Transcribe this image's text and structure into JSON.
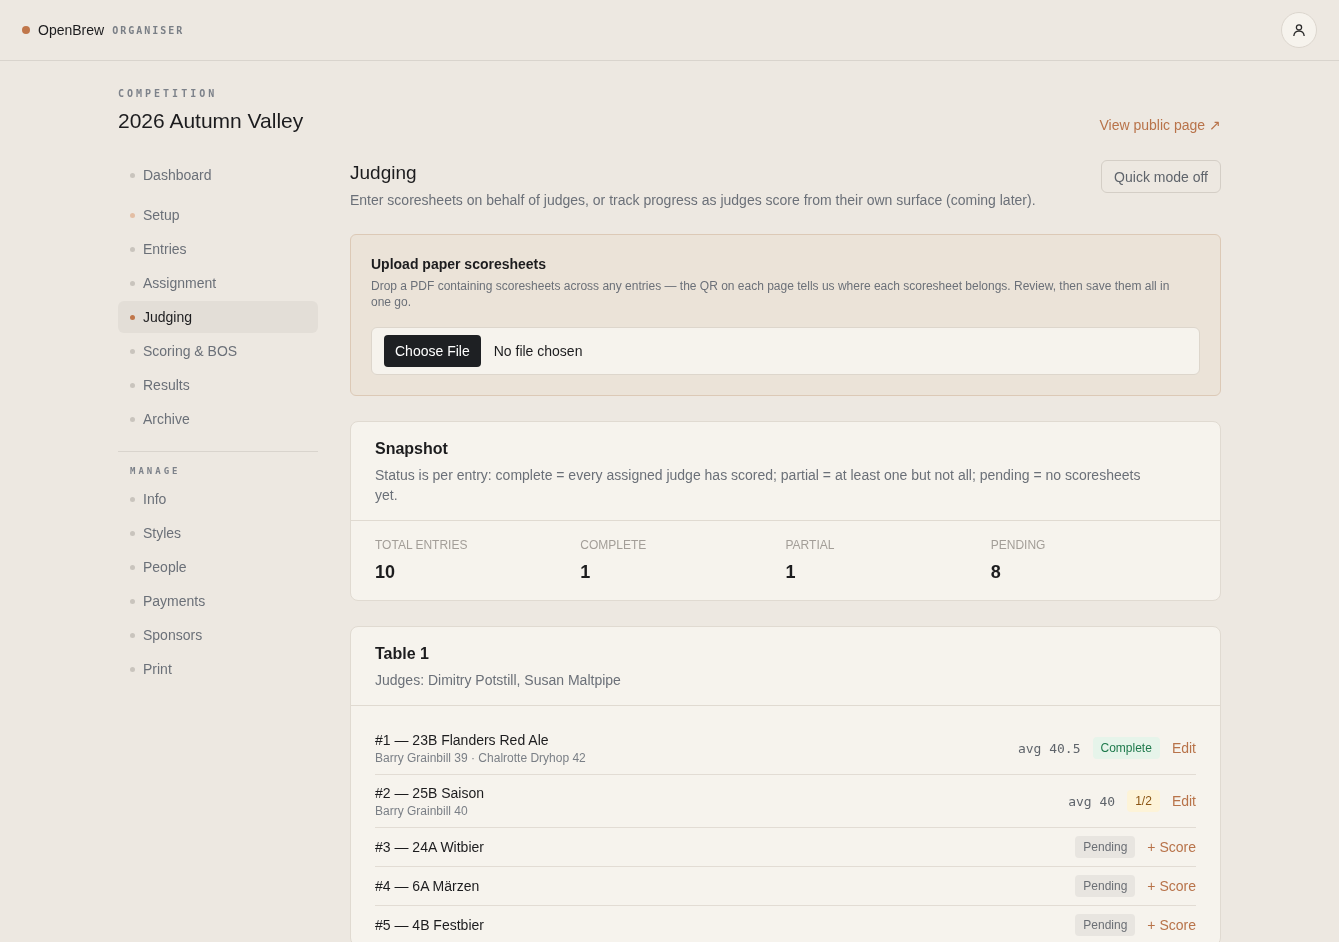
{
  "brand": {
    "name": "OpenBrew",
    "tag": "ORGANISER"
  },
  "competition": {
    "label": "COMPETITION",
    "title": "2026 Autumn Valley",
    "public_link": "View public page ↗"
  },
  "sidebar": {
    "groups": [
      {
        "items": [
          {
            "label": "Dashboard",
            "color": "#c9c4bd",
            "selected": false
          }
        ]
      },
      {
        "items": [
          {
            "label": "Setup",
            "color": "#e3bea4",
            "selected": false
          },
          {
            "label": "Entries",
            "color": "#c9c4bd",
            "selected": false
          },
          {
            "label": "Assignment",
            "color": "#c9c4bd",
            "selected": false
          },
          {
            "label": "Judging",
            "color": "#c0764a",
            "selected": true
          },
          {
            "label": "Scoring & BOS",
            "color": "#c9c4bd",
            "selected": false
          },
          {
            "label": "Results",
            "color": "#c9c4bd",
            "selected": false
          },
          {
            "label": "Archive",
            "color": "#c9c4bd",
            "selected": false
          }
        ]
      },
      {
        "heading": "MANAGE",
        "items": [
          {
            "label": "Info",
            "color": "#c9c4bd",
            "selected": false
          },
          {
            "label": "Styles",
            "color": "#c9c4bd",
            "selected": false
          },
          {
            "label": "People",
            "color": "#c9c4bd",
            "selected": false
          },
          {
            "label": "Payments",
            "color": "#c9c4bd",
            "selected": false
          },
          {
            "label": "Sponsors",
            "color": "#c9c4bd",
            "selected": false
          },
          {
            "label": "Print",
            "color": "#c9c4bd",
            "selected": false
          }
        ]
      }
    ]
  },
  "page": {
    "title": "Judging",
    "subtitle": "Enter scoresheets on behalf of judges, or track progress as judges score from their own surface (coming later).",
    "quick_mode_button": "Quick mode off"
  },
  "upload": {
    "title": "Upload paper scoresheets",
    "description": "Drop a PDF containing scoresheets across any entries — the QR on each page tells us where each scoresheet belongs. Review, then save them all in one go.",
    "button": "Choose File",
    "file_status": "No file chosen"
  },
  "snapshot": {
    "title": "Snapshot",
    "description": "Status is per entry: complete = every assigned judge has scored; partial = at least one but not all; pending = no scoresheets yet.",
    "stats": [
      {
        "label": "TOTAL ENTRIES",
        "value": "10"
      },
      {
        "label": "COMPLETE",
        "value": "1"
      },
      {
        "label": "PARTIAL",
        "value": "1"
      },
      {
        "label": "PENDING",
        "value": "8"
      }
    ]
  },
  "table": {
    "title": "Table 1",
    "judges": "Judges: Dimitry Potstill, Susan Maltpipe",
    "entries": [
      {
        "title": "#1 — 23B Flanders Red Ale",
        "scores": "Barry Grainbill 39 · Chalrotte Dryhop 42",
        "average": "avg 40.5",
        "status": {
          "kind": "complete",
          "label": "Complete"
        },
        "action": "Edit"
      },
      {
        "title": "#2 — 25B Saison",
        "scores": "Barry Grainbill 40",
        "average": "avg 40",
        "status": {
          "kind": "partial",
          "label": "1/2"
        },
        "action": "Edit"
      },
      {
        "title": "#3 — 24A Witbier",
        "status": {
          "kind": "pending",
          "label": "Pending"
        },
        "action": "+ Score"
      },
      {
        "title": "#4 — 6A Märzen",
        "status": {
          "kind": "pending",
          "label": "Pending"
        },
        "action": "+ Score"
      },
      {
        "title": "#5 — 4B Festbier",
        "status": {
          "kind": "pending",
          "label": "Pending"
        },
        "action": "+ Score"
      }
    ]
  }
}
